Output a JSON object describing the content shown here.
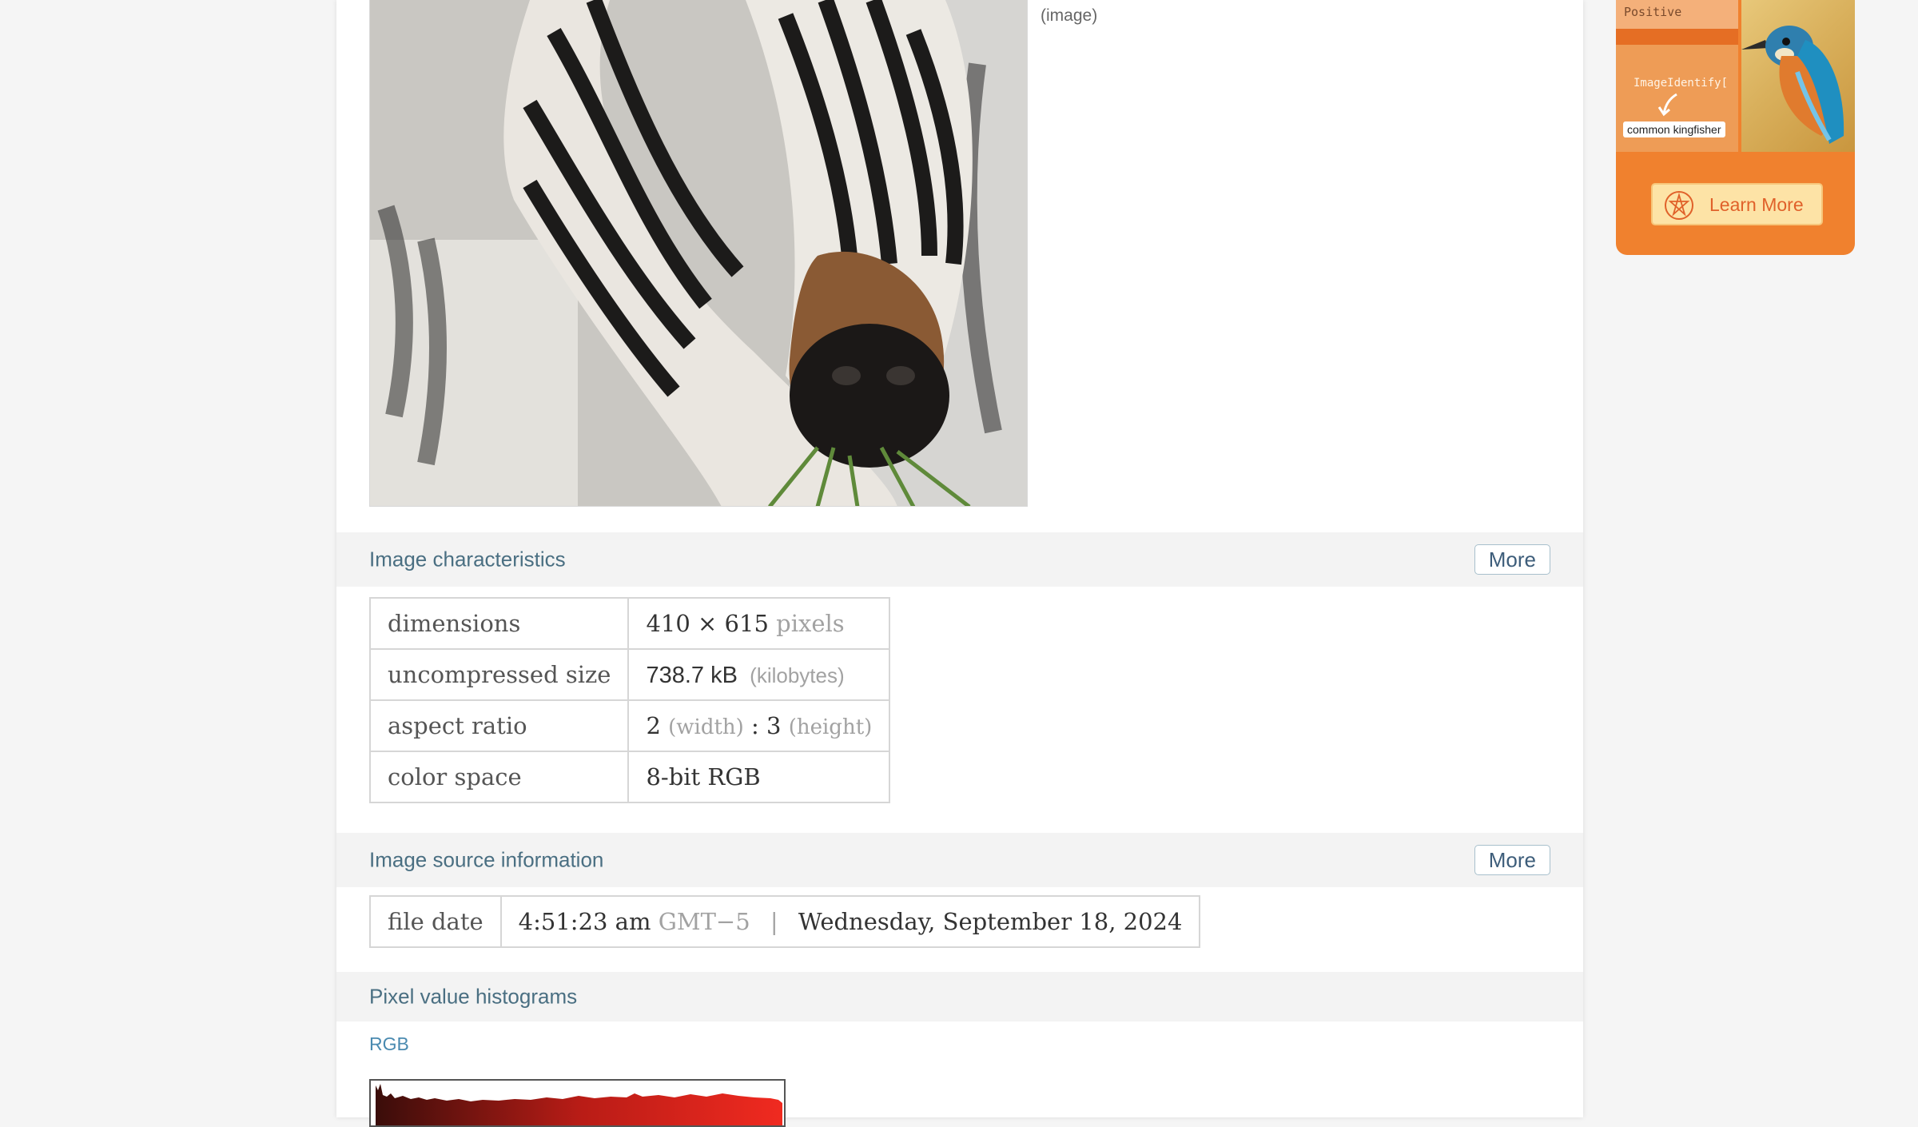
{
  "image_caption": "(image)",
  "sections": {
    "characteristics": {
      "title": "Image characteristics",
      "more_label": "More",
      "rows": [
        {
          "label": "dimensions",
          "value": "410 × 615",
          "unit": "pixels"
        },
        {
          "label": "uncompressed size",
          "value": "738.7 kB",
          "unit": "(kilobytes)"
        },
        {
          "label": "aspect ratio",
          "value_width": "2",
          "width_note": "(width)",
          "separator": ":",
          "value_height": "3",
          "height_note": "(height)"
        },
        {
          "label": "color space",
          "value": "8-bit RGB"
        }
      ]
    },
    "source": {
      "title": "Image source information",
      "more_label": "More",
      "row": {
        "label": "file date",
        "time": "4:51:23 am",
        "timezone": "GMT−5",
        "divider": "|",
        "date": "Wednesday, September 18, 2024"
      }
    },
    "histograms": {
      "title": "Pixel value histograms",
      "channel_label": "RGB"
    }
  },
  "ad": {
    "positive_label": "Positive",
    "function_label": "ImageIdentify[",
    "result_tag": "common kingfisher",
    "button_label": "Learn More"
  },
  "colors": {
    "link_blue": "#4a6f82",
    "ad_orange": "#f0812e",
    "histogram_red": "#e8261e"
  },
  "icons": {
    "ad_button_icon": "wolfram-spikey-icon",
    "ad_arrow": "checkmark-arrow-icon"
  }
}
